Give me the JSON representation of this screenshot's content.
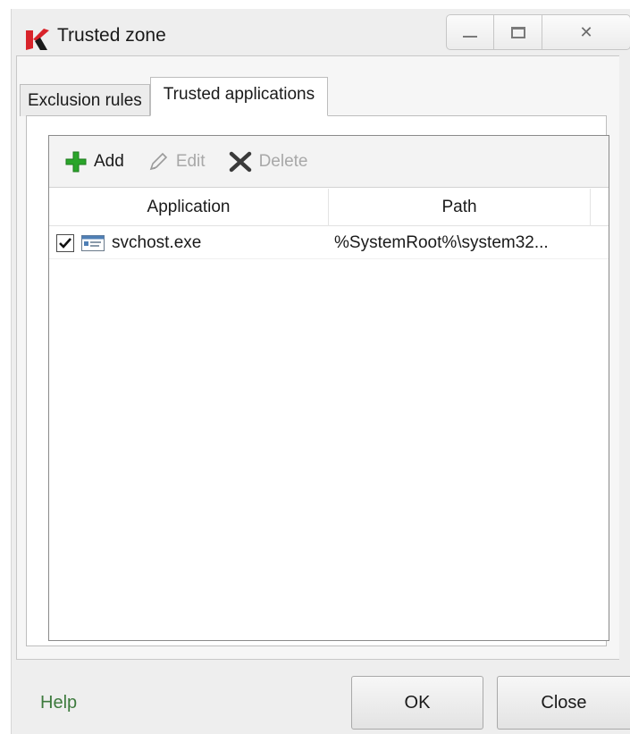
{
  "window": {
    "title": "Trusted zone",
    "logo_icon": "kaspersky-k-logo",
    "minimize_icon": "minimize-icon",
    "maximize_icon": "maximize-icon",
    "close_glyph": "✕"
  },
  "tabs": [
    {
      "label": "Exclusion rules",
      "active": false
    },
    {
      "label": "Trusted applications",
      "active": true
    }
  ],
  "toolbar": {
    "add_label": "Add",
    "add_icon": "plus-icon",
    "edit_label": "Edit",
    "edit_icon": "pencil-icon",
    "delete_label": "Delete",
    "delete_icon": "x-delete-icon"
  },
  "table": {
    "columns": [
      "Application",
      "Path"
    ],
    "rows": [
      {
        "checked": true,
        "icon": "application-window-icon",
        "application": "svchost.exe",
        "path": "%SystemRoot%\\system32..."
      }
    ]
  },
  "footer": {
    "help_label": "Help",
    "ok_label": "OK",
    "close_label": "Close"
  },
  "colors": {
    "help_link": "#3d7a3d",
    "add_icon": "#2aa52a",
    "brand_red": "#d8232a"
  }
}
